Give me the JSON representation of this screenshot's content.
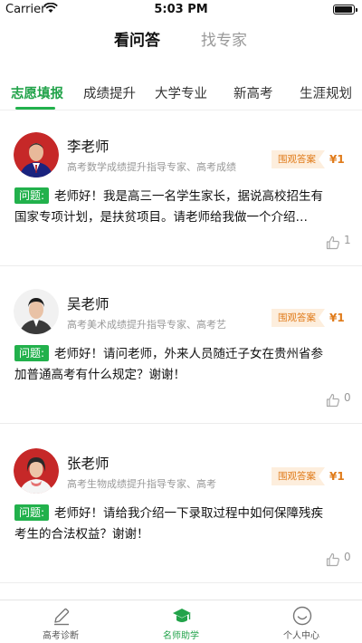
{
  "status_bar": {
    "carrier": "Carrier",
    "time": "5:03 PM",
    "battery_level": 0.95
  },
  "header": {
    "tabs": [
      {
        "label": "看问答",
        "active": true
      },
      {
        "label": "找专家",
        "active": false
      }
    ]
  },
  "categories": [
    {
      "label": "志愿填报",
      "active": true
    },
    {
      "label": "成绩提升",
      "active": false
    },
    {
      "label": "大学专业",
      "active": false
    },
    {
      "label": "新高考",
      "active": false
    },
    {
      "label": "生涯规划",
      "active": false
    }
  ],
  "cards": [
    {
      "name": "李老师",
      "desc": "高考数学成绩提升指导专家、高考成绩",
      "tag": "围观答案",
      "price": "¥1",
      "q_label": "问题:",
      "question": "老师好！我是高三一名学生家长，据说高校招生有国家专项计划，是扶贫项目。请老师给我做一个介绍…",
      "likes": "1"
    },
    {
      "name": "吴老师",
      "desc": "高考美术成绩提升指导专家、高考艺",
      "tag": "围观答案",
      "price": "¥1",
      "q_label": "问题:",
      "question": "老师好！请问老师，外来人员随迁子女在贵州省参加普通高考有什么规定？谢谢！",
      "likes": "0"
    },
    {
      "name": "张老师",
      "desc": "高考生物成绩提升指导专家、高考",
      "tag": "围观答案",
      "price": "¥1",
      "q_label": "问题:",
      "question": "老师好！请给我介绍一下录取过程中如何保障残疾考生的合法权益？谢谢！",
      "likes": "0"
    }
  ],
  "bottom_nav": [
    {
      "label": "高考诊断",
      "icon": "pencil-icon",
      "active": false
    },
    {
      "label": "名师助学",
      "icon": "graduation-cap-icon",
      "active": true
    },
    {
      "label": "个人中心",
      "icon": "smiley-face-icon",
      "active": false
    }
  ],
  "colors": {
    "accent": "#22b14c",
    "price": "#e07b1a",
    "tag_bg": "#fdeedd"
  }
}
